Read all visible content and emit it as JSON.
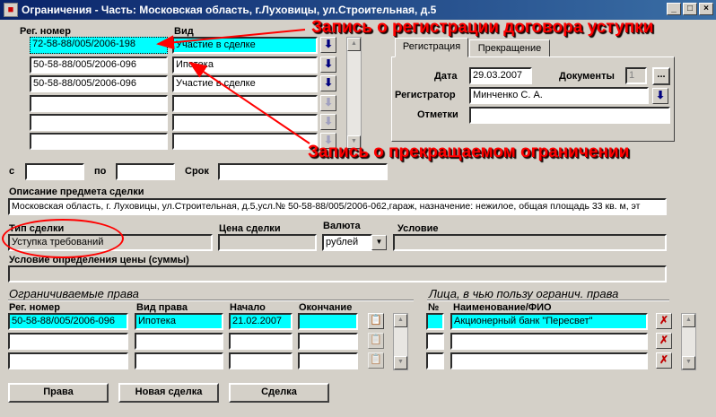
{
  "window": {
    "title": "Ограничения - Часть: Московская область, г.Луховицы, ул.Строительная, д.5",
    "min_label": "_",
    "max_label": "□",
    "close_label": "×"
  },
  "reg_list": {
    "col_reg": "Рег. номер",
    "col_kind": "Вид",
    "rows": [
      {
        "reg": "72-58-88/005/2006-198",
        "kind": "Участие в сделке"
      },
      {
        "reg": "50-58-88/005/2006-096",
        "kind": "Ипотека"
      },
      {
        "reg": "50-58-88/005/2006-096",
        "kind": "Участие в сделке"
      },
      {
        "reg": "",
        "kind": ""
      },
      {
        "reg": "",
        "kind": ""
      },
      {
        "reg": "",
        "kind": ""
      }
    ]
  },
  "tabs": [
    {
      "label": "Регистрация"
    },
    {
      "label": "Прекращение"
    }
  ],
  "registration": {
    "date_label": "Дата",
    "date_value": "29.03.2007",
    "docs_label": "Документы",
    "docs_value": "1",
    "docs_btn": "...",
    "registrar_label": "Регистратор",
    "registrar_value": "Минченко С. А.",
    "notes_label": "Отметки",
    "notes_value": ""
  },
  "period": {
    "from_label": "с",
    "from_value": "",
    "to_label": "по",
    "to_value": "",
    "term_label": "Срок",
    "term_value": ""
  },
  "subject": {
    "label": "Описание предмета сделки",
    "value": "Московская область, г. Луховицы, ул.Строительная, д.5,усл.№ 50-58-88/005/2006-062,гараж, назначение: нежилое, общая площадь 33 кв. м, эт"
  },
  "deal": {
    "type_label": "Тип сделки",
    "type_value": "Уступка требований",
    "price_label": "Цена сделки",
    "price_value": "",
    "currency_label": "Валюта",
    "currency_value": "рублей",
    "condition_label": "Условие",
    "condition_value": "",
    "price_cond_label": "Условие определения цены (суммы)",
    "price_cond_value": ""
  },
  "limited_rights": {
    "section_title": "Ограничиваемые права",
    "col_reg": "Рег. номер",
    "col_kind": "Вид права",
    "col_start": "Начало",
    "col_end": "Окончание",
    "rows": [
      {
        "reg": "50-58-88/005/2006-096",
        "kind": "Ипотека",
        "start": "21.02.2007",
        "end": ""
      },
      {
        "reg": "",
        "kind": "",
        "start": "",
        "end": ""
      },
      {
        "reg": "",
        "kind": "",
        "start": "",
        "end": ""
      }
    ]
  },
  "beneficiaries": {
    "section_title": "Лица, в чью пользу огранич. права",
    "col_num": "№",
    "col_name": "Наименование/ФИО",
    "rows": [
      {
        "num": "",
        "name": "Акционерный банк \"Пересвет\""
      },
      {
        "num": "",
        "name": ""
      },
      {
        "num": "",
        "name": ""
      }
    ]
  },
  "buttons": {
    "rights": "Права",
    "new_deal": "Новая сделка",
    "deal": "Сделка"
  },
  "annotations": {
    "top": "Запись о регистрации договора уступки",
    "bottom": "Запись о прекращаемом ограничении"
  },
  "colors": {
    "highlight": "#00ffff",
    "annotation": "#ff0000",
    "title_bar": "#0a246a"
  }
}
